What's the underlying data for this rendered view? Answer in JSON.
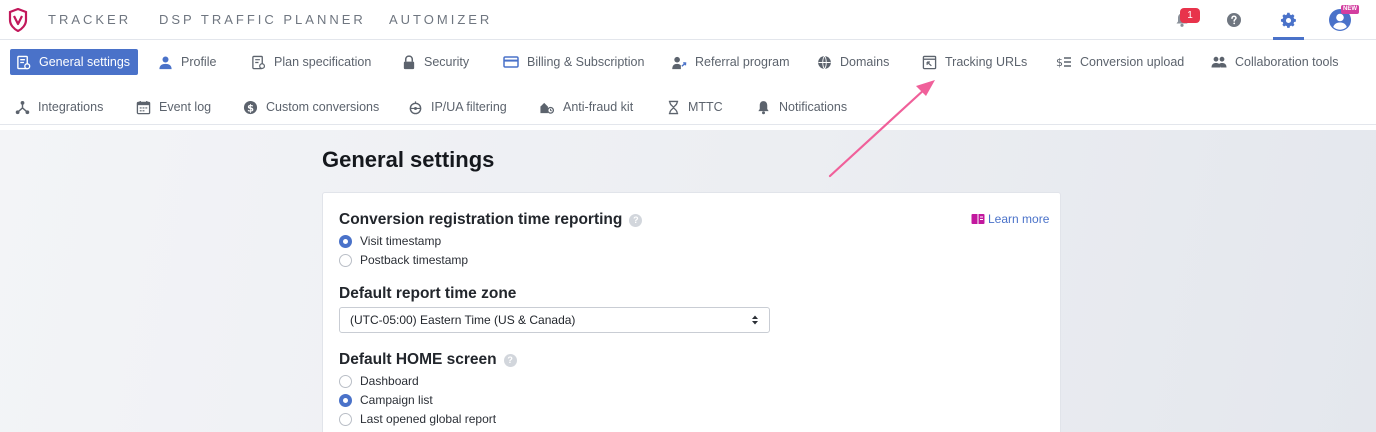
{
  "header": {
    "nav": [
      "TRACKER",
      "DSP TRAFFIC PLANNER",
      "AUTOMIZER"
    ],
    "notification_count": "1",
    "profile_badge": "NEW"
  },
  "tabs": {
    "row1": [
      {
        "label": "General settings",
        "icon": "general-settings-icon",
        "active": true
      },
      {
        "label": "Profile",
        "icon": "person-icon"
      },
      {
        "label": "Plan specification",
        "icon": "plan-icon"
      },
      {
        "label": "Security",
        "icon": "lock-icon"
      },
      {
        "label": "Billing & Subscription",
        "icon": "credit-card-icon"
      },
      {
        "label": "Referral program",
        "icon": "referral-icon"
      },
      {
        "label": "Domains",
        "icon": "globe-icon"
      },
      {
        "label": "Tracking URLs",
        "icon": "tracking-url-icon"
      },
      {
        "label": "Conversion upload",
        "icon": "conversion-upload-icon"
      },
      {
        "label": "Collaboration tools",
        "icon": "people-icon"
      }
    ],
    "row2": [
      {
        "label": "Integrations",
        "icon": "integrations-icon"
      },
      {
        "label": "Event log",
        "icon": "calendar-icon"
      },
      {
        "label": "Custom conversions",
        "icon": "dollar-icon"
      },
      {
        "label": "IP/UA filtering",
        "icon": "filter-icon"
      },
      {
        "label": "Anti-fraud kit",
        "icon": "anti-fraud-icon"
      },
      {
        "label": "MTTC",
        "icon": "hourglass-icon"
      },
      {
        "label": "Notifications",
        "icon": "bell-icon"
      }
    ]
  },
  "page": {
    "title": "General settings",
    "learn_more": "Learn more",
    "conversion_section": {
      "title": "Conversion registration time reporting",
      "options": [
        "Visit timestamp",
        "Postback timestamp"
      ],
      "selected": "Visit timestamp"
    },
    "timezone_section": {
      "title": "Default report time zone",
      "value": "(UTC-05:00) Eastern Time (US & Canada)"
    },
    "home_section": {
      "title": "Default HOME screen",
      "options": [
        "Dashboard",
        "Campaign list",
        "Last opened global report"
      ],
      "selected": "Campaign list"
    }
  },
  "colors": {
    "accent": "#4a72c9",
    "logo": "#c2185b",
    "badge": "#e8334b",
    "annotation_arrow": "#f0609a"
  }
}
